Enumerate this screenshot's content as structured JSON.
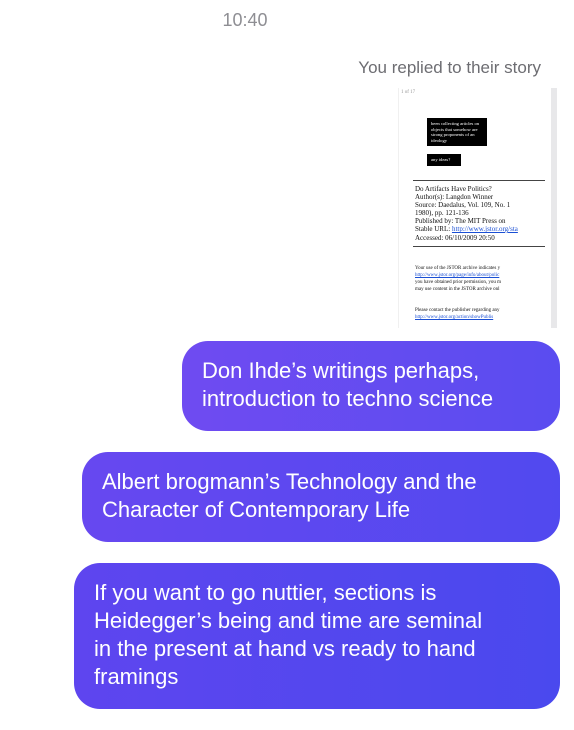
{
  "header": {
    "timestamp": "10:40",
    "story_reply_label": "You replied to their story"
  },
  "story_preview": {
    "page_count": "1 of 17",
    "sticker_text_1": "been collecting articles on objects that somehow are strong proponents of an ideology",
    "sticker_text_2": "any ideas?",
    "doc_title": "Do Artifacts Have Politics?",
    "doc_author": "Author(s): Langdon Winner",
    "doc_source": "Source: Daedalus, Vol. 109, No. 1",
    "doc_year": "1980), pp. 121-136",
    "doc_publisher": "Published by: The MIT Press on",
    "doc_stable_url_label": "Stable URL:",
    "doc_stable_url": "http://www.jstor.org/sta",
    "doc_accessed": "Accessed: 06/10/2009 20:50",
    "terms_line_1": "Your use of the JSTOR archive indicates y",
    "terms_link_1": "http://www.jstor.org/page/info/about/polic",
    "terms_line_2": "you have obtained prior permission, you m",
    "terms_line_3": "may use content in the JSTOR archive onl",
    "contact_line": "Please contact the publisher regarding any",
    "contact_link": "http://www.jstor.org/action/showPublis"
  },
  "messages": [
    {
      "lines": [
        "Don Ihde’s writings perhaps,",
        "introduction to techno science"
      ]
    },
    {
      "lines": [
        "Albert brogmann’s Technology and the",
        "Character of Contemporary Life"
      ]
    },
    {
      "lines": [
        "If you want to go nuttier, sections is",
        "Heidegger’s being and time are seminal",
        "in the present at hand vs ready to hand",
        "framings"
      ]
    }
  ],
  "colors": {
    "bubble_start": "#6f4bf1",
    "bubble_end": "#4a49ee",
    "timestamp_gray": "#8e8e93"
  }
}
